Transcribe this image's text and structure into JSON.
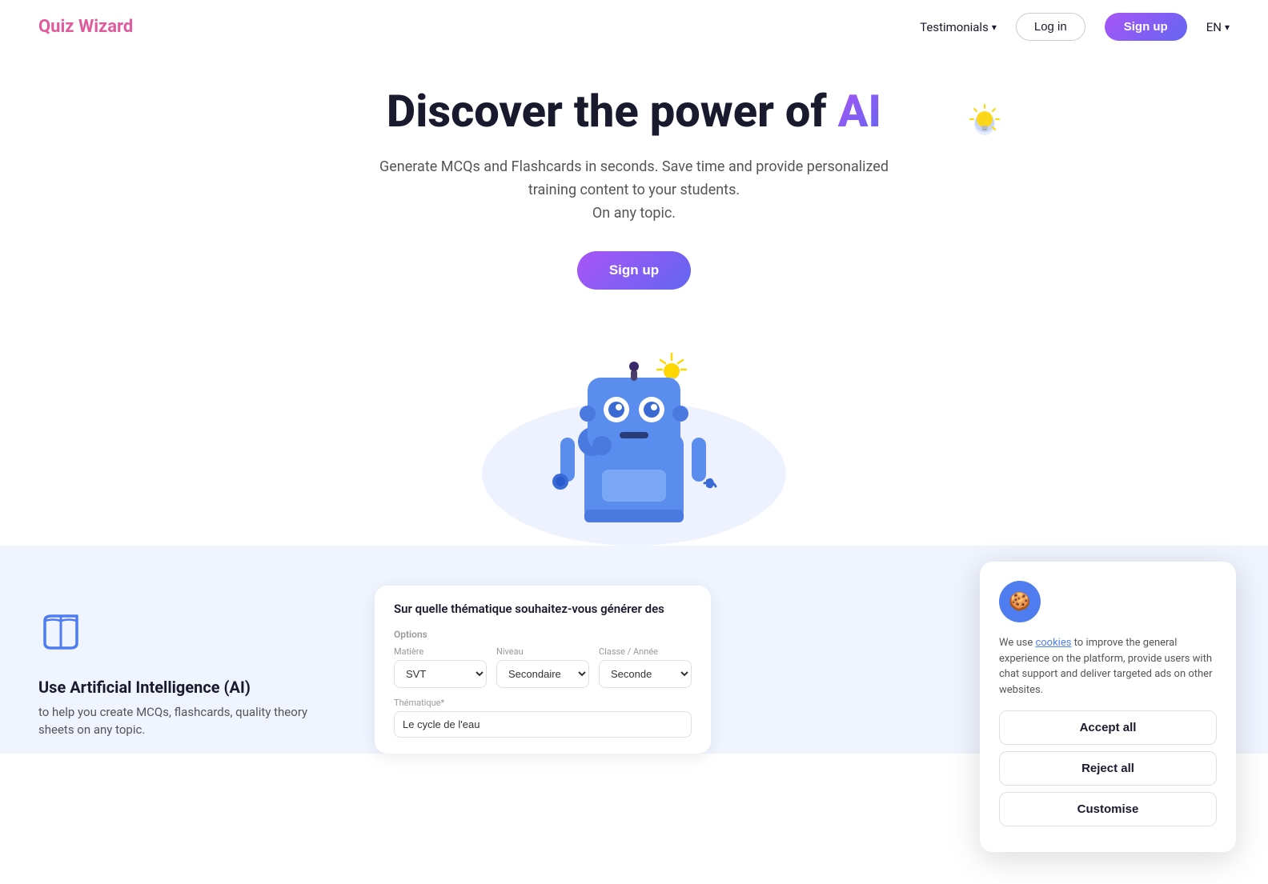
{
  "nav": {
    "logo": "Quiz Wizard",
    "testimonials": "Testimonials",
    "login": "Log in",
    "signup": "Sign up",
    "lang": "EN"
  },
  "hero": {
    "title_start": "Discover the power of ",
    "title_ai": "AI",
    "subtitle_line1": "Generate MCQs and Flashcards in seconds. Save time and provide personalized",
    "subtitle_line2": "training content to your students.",
    "subtitle_line3": "On any topic.",
    "cta": "Sign up",
    "lightbulb": "💡"
  },
  "bottom": {
    "book_icon": "📖",
    "heading": "Use Artificial Intelligence (AI)",
    "subtext": "to help you create MCQs, flashcards, quality theory sheets on any topic.",
    "quiz_card": {
      "title": "Sur quelle thématique souhaitez-vous générer des",
      "options_label": "Options",
      "matiere_label": "Matière",
      "matiere_value": "SVT",
      "niveau_label": "Niveau",
      "niveau_value": "Secondaire",
      "classe_label": "Classe / Année",
      "classe_value": "Seconde",
      "theme_label": "Thématique*",
      "theme_value": "Le cycle de l'eau"
    }
  },
  "cookie": {
    "icon": "🍪",
    "text_before_link": "We use ",
    "link_text": "cookies",
    "text_after_link": " to improve the general experience on the platform, provide users with chat support and deliver targeted ads on other websites.",
    "accept_all": "Accept all",
    "reject_all": "Reject all",
    "customise": "Customise"
  }
}
